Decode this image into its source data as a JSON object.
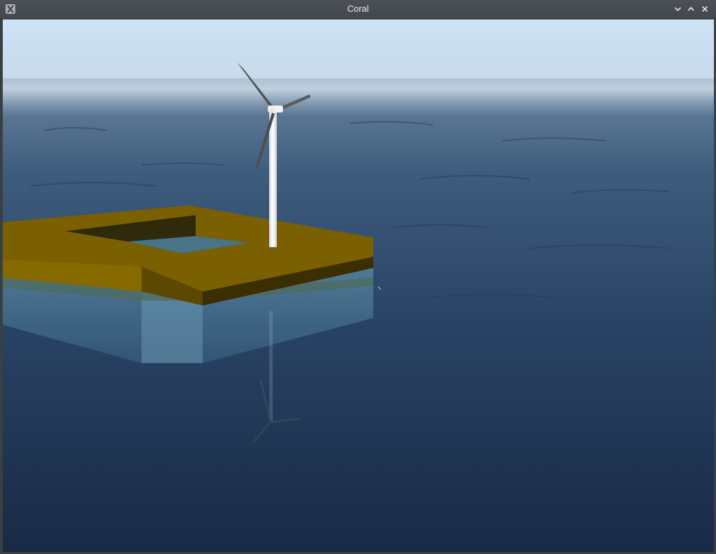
{
  "window": {
    "title": "Coral",
    "app_icon": "x11-logo-icon",
    "controls": {
      "minimize": "chevron-down-icon",
      "maximize": "chevron-up-icon",
      "close": "close-icon"
    }
  },
  "scene": {
    "description_icons": [
      "wind-turbine",
      "floating-platform",
      "ocean"
    ],
    "colors": {
      "sky_top": "#cfe3f6",
      "horizon_fog": "#b8c8d6",
      "sea_far": "#3d5a7a",
      "sea_near": "#1a2b46",
      "platform_top": "#7a6000",
      "platform_side": "#5a4500",
      "turbine": "#f2f2f2",
      "blade": "#4b4d50"
    }
  }
}
